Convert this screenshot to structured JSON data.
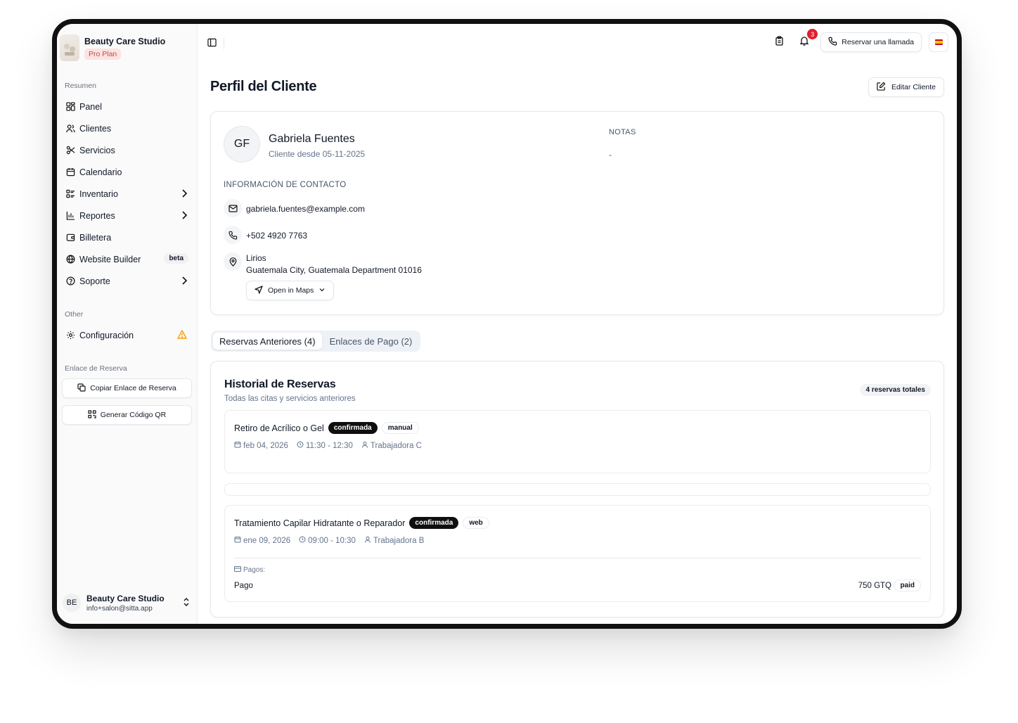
{
  "sidebar": {
    "brand_name": "Beauty Care Studio",
    "plan_badge": "Pro Plan",
    "section_overview": "Resumen",
    "items": [
      {
        "label": "Panel"
      },
      {
        "label": "Clientes"
      },
      {
        "label": "Servicios"
      },
      {
        "label": "Calendario"
      },
      {
        "label": "Inventario"
      },
      {
        "label": "Reportes"
      },
      {
        "label": "Billetera"
      },
      {
        "label": "Website Builder",
        "badge": "beta"
      },
      {
        "label": "Soporte"
      }
    ],
    "section_other": "Other",
    "settings_label": "Configuración",
    "section_booking_link": "Enlace de Reserva",
    "copy_link_label": "Copiar Enlace de Reserva",
    "qr_label": "Generar Código QR",
    "user": {
      "initials": "BE",
      "name": "Beauty Care Studio",
      "email": "info+salon@sitta.app"
    }
  },
  "topbar": {
    "notification_count": "3",
    "call_button_label": "Reservar una llamada",
    "language_icon": "spain-flag-icon"
  },
  "page": {
    "title": "Perfil del Cliente",
    "edit_button_label": "Editar Cliente"
  },
  "client": {
    "initials": "GF",
    "name": "Gabriela Fuentes",
    "since": "Cliente desde 05-11-2025",
    "notes_label": "NOTAS",
    "notes_value": "-",
    "contact_label": "INFORMACIÓN DE CONTACTO",
    "email": "gabriela.fuentes@example.com",
    "phone": "+502 4920 7763",
    "address_line1": "Lirios",
    "address_line2": "Guatemala City, Guatemala Department 01016",
    "maps_button_label": "Open in Maps"
  },
  "tabs": [
    {
      "label": "Reservas Anteriores (4)",
      "active": true
    },
    {
      "label": "Enlaces de Pago (2)",
      "active": false
    }
  ],
  "history": {
    "title": "Historial de Reservas",
    "subtitle": "Todas las citas y servicios anteriores",
    "total_badge": "4 reservas totales",
    "bookings": [
      {
        "service": "Retiro de Acrílico o Gel",
        "status": "confirmada",
        "source": "manual",
        "date": "feb 04, 2026",
        "time": "11:30 - 12:30",
        "worker": "Trabajadora C"
      },
      {
        "service": "Tratamiento Capilar Hidratante o Reparador",
        "status": "confirmada",
        "source": "web",
        "date": "ene 09, 2026",
        "time": "09:00 - 10:30",
        "worker": "Trabajadora B",
        "payments_label": "Pagos:",
        "payment_name": "Pago",
        "payment_amount": "750 GTQ",
        "payment_status": "paid"
      }
    ]
  },
  "colors": {
    "accent_dark": "#0f0f0f",
    "notification_red": "#e11d2e",
    "warning": "#f59e0b",
    "pro_badge_bg": "#fde2e1",
    "pro_badge_text": "#b4534e"
  }
}
